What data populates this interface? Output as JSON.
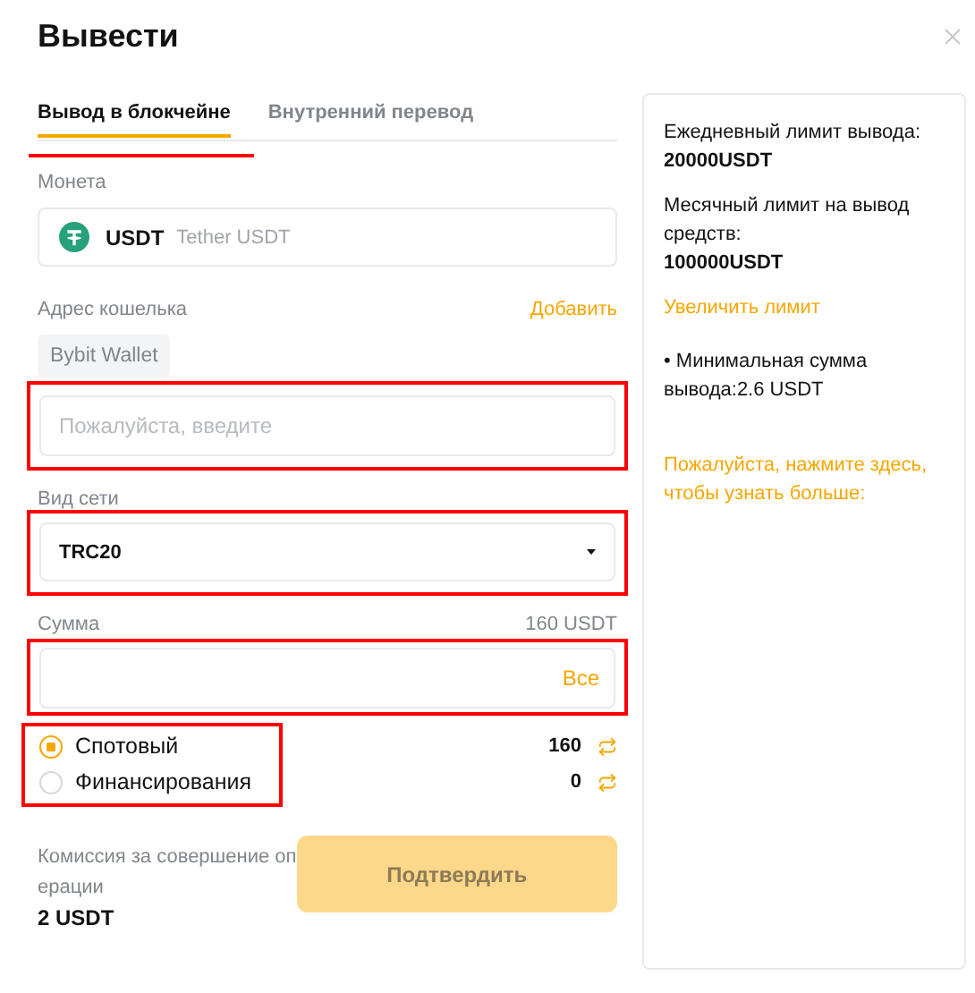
{
  "dialog": {
    "title": "Вывести"
  },
  "tabs": [
    {
      "label": "Вывод в блокчейне",
      "selected": true,
      "highlighted": true
    },
    {
      "label": "Внутренний перевод",
      "selected": false,
      "highlighted": false
    }
  ],
  "coin": {
    "label": "Монета",
    "symbol": "USDT",
    "name": "Tether USDT"
  },
  "address": {
    "label": "Адрес кошелька",
    "action": "Добавить",
    "wallet_chip": "Bybit Wallet",
    "placeholder": "Пожалуйста, введите",
    "highlighted": true
  },
  "network": {
    "label": "Вид сети",
    "value": "TRC20",
    "highlighted": true
  },
  "amount": {
    "label": "Сумма",
    "available": "160 USDT",
    "all_button": "Все",
    "highlighted": true
  },
  "accounts": {
    "highlighted": true,
    "items": [
      {
        "label": "Спотовый",
        "balance": "160",
        "selected": true
      },
      {
        "label": "Финансирования",
        "balance": "0",
        "selected": false
      }
    ]
  },
  "fee": {
    "label_lines": [
      "Комиссия за совершение оп",
      "ерации"
    ],
    "value": "2 USDT"
  },
  "confirm_button": {
    "label": "Подтвердить",
    "disabled": true
  },
  "limits": [
    {
      "kind": "limit",
      "label": "Ежедневный лимит вывода:",
      "value": "20000USDT"
    },
    {
      "kind": "limit",
      "label": "Месячный лимит на вывод средств:",
      "value": "100000USDT"
    },
    {
      "kind": "link",
      "text": "Увеличить лимит"
    },
    {
      "kind": "note",
      "text": "• Минимальная сумма вывода:2.6 USDT"
    },
    {
      "kind": "link",
      "text": "Пожалуйста, нажмите здесь, чтобы узнать больше:"
    }
  ]
}
